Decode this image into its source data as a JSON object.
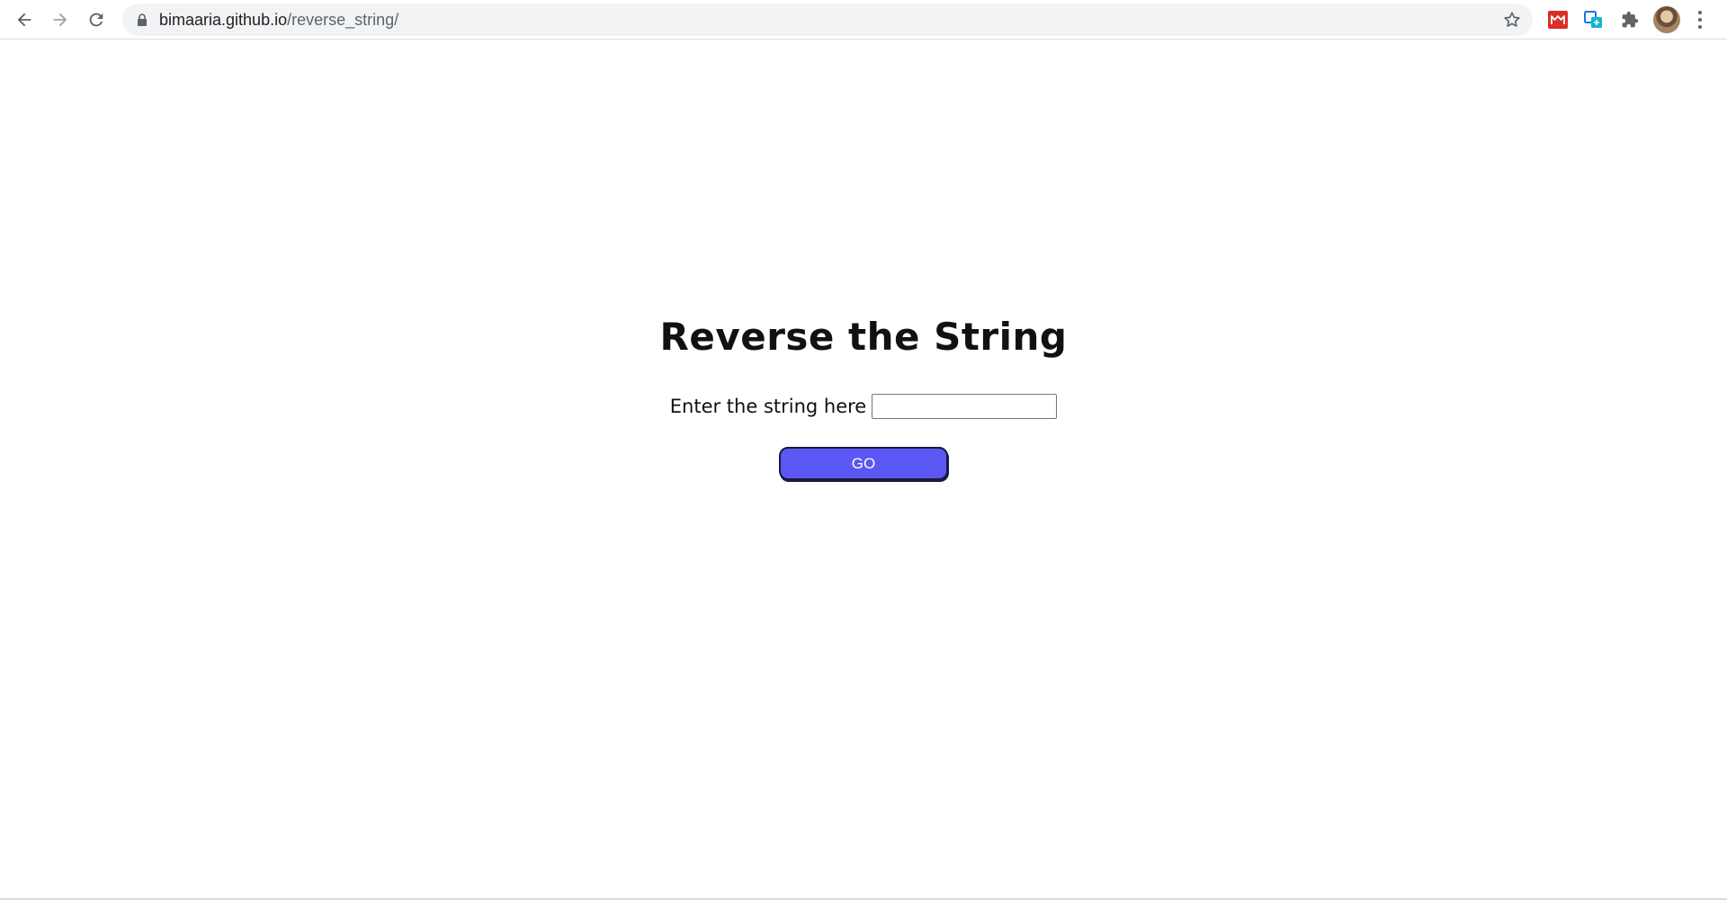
{
  "browser": {
    "url_host": "bimaaria.github.io",
    "url_path": "/reverse_string/",
    "icons": {
      "back": "back-arrow-icon",
      "forward": "forward-arrow-icon",
      "reload": "reload-icon",
      "lock": "lock-icon",
      "bookmark": "star-icon",
      "extension_red": "red-extension-icon",
      "extension_teal": "translate-extension-icon",
      "extensions": "puzzle-piece-icon",
      "profile": "avatar",
      "menu": "three-dot-menu-icon"
    },
    "colors": {
      "toolbar_bg": "#ffffff",
      "omnibox_bg": "#f1f3f4",
      "icon": "#5f6368"
    }
  },
  "main": {
    "title": "Reverse the String",
    "input_label": "Enter the string here",
    "input_value": "",
    "go_label": "GO"
  },
  "colors": {
    "button_bg": "#5b57f4",
    "button_text": "#ffffff",
    "text": "#111111"
  }
}
